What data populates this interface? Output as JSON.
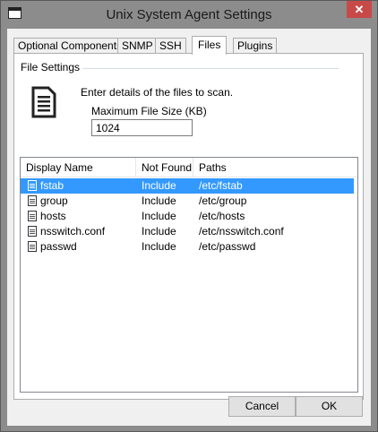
{
  "window": {
    "title": "Unix System Agent Settings",
    "close_symbol": "✕"
  },
  "tabs": [
    {
      "label": "Optional Components"
    },
    {
      "label": "SNMP"
    },
    {
      "label": "SSH"
    },
    {
      "label": "Files",
      "active": true
    },
    {
      "label": "Plugins"
    }
  ],
  "file_settings": {
    "group_label": "File Settings",
    "icon": "document-icon",
    "hint": "Enter details of the files to scan.",
    "max_size_label": "Maximum File Size (KB)",
    "max_size_value": "1024"
  },
  "list": {
    "columns": [
      "Display Name",
      "Not Found",
      "Paths"
    ],
    "rows": [
      {
        "name": "fstab",
        "not_found": "Include",
        "path": "/etc/fstab",
        "selected": true
      },
      {
        "name": "group",
        "not_found": "Include",
        "path": "/etc/group"
      },
      {
        "name": "hosts",
        "not_found": "Include",
        "path": "/etc/hosts"
      },
      {
        "name": "nsswitch.conf",
        "not_found": "Include",
        "path": "/etc/nsswitch.conf"
      },
      {
        "name": "passwd",
        "not_found": "Include",
        "path": "/etc/passwd"
      }
    ]
  },
  "buttons": {
    "cancel": "Cancel",
    "ok": "OK"
  },
  "colors": {
    "selection": "#3399ff",
    "close_button": "#c74a48",
    "frame": "#8c8c8c"
  }
}
